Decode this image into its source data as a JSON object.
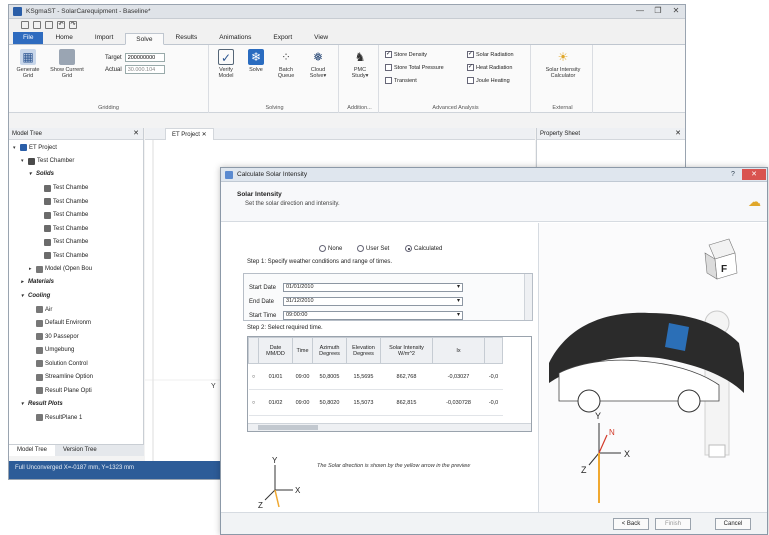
{
  "window": {
    "title": "KSgmaST - SolarCarequipment - Baseline*",
    "controls": [
      "—",
      "❐",
      "✕"
    ]
  },
  "ribbon_tabs": [
    "File",
    "Home",
    "Import",
    "Solve",
    "Results",
    "Animations",
    "Export",
    "View"
  ],
  "ribbon": {
    "grid_group": {
      "label": "Gridding",
      "generate_grid": "Generate Grid",
      "show_current_grid": "Show Current Grid",
      "target_label": "Target",
      "target_value": "200000000",
      "actual_label": "Actual",
      "actual_value": "30.000.104"
    },
    "solving_group": {
      "label": "Solving",
      "verify_model": "Verify Model",
      "solve": "Solve",
      "batch_queue": "Batch Queue",
      "cloud_solve": "Cloud Solve▾"
    },
    "addition_group": {
      "label": "Addition...",
      "pmc_study": "PMC Study▾"
    },
    "analysis_group": {
      "label": "Advanced Analysis",
      "checks": [
        {
          "label": "Store Density",
          "checked": true
        },
        {
          "label": "Solar Radiation",
          "checked": true
        },
        {
          "label": "Store Total Pressure",
          "checked": false
        },
        {
          "label": "Heat Radiation",
          "checked": true
        },
        {
          "label": "Transient",
          "checked": false
        },
        {
          "label": "Joule Heating",
          "checked": false
        }
      ]
    },
    "external_group": {
      "label": "External",
      "solar_calc": "Solar Intensity Calculator"
    }
  },
  "model_tree": {
    "title": "Model Tree",
    "nodes": [
      {
        "label": "ET Project",
        "indent": 0,
        "arrow": "▾",
        "style": "normal"
      },
      {
        "label": "Test Chamber",
        "indent": 1,
        "arrow": "▾",
        "style": "normal"
      },
      {
        "label": "Solids",
        "indent": 2,
        "arrow": "▾",
        "style": "italic"
      },
      {
        "label": "Test Chambe",
        "indent": 3,
        "arrow": "",
        "style": "normal"
      },
      {
        "label": "Test Chambe",
        "indent": 3,
        "arrow": "",
        "style": "normal"
      },
      {
        "label": "Test Chambe",
        "indent": 3,
        "arrow": "",
        "style": "normal"
      },
      {
        "label": "Test Chambe",
        "indent": 3,
        "arrow": "",
        "style": "normal"
      },
      {
        "label": "Test Chambe",
        "indent": 3,
        "arrow": "",
        "style": "normal"
      },
      {
        "label": "Test Chambe",
        "indent": 3,
        "arrow": "",
        "style": "normal"
      },
      {
        "label": "Model (Open Bou",
        "indent": 2,
        "arrow": "▸",
        "style": "normal"
      },
      {
        "label": "Materials",
        "indent": 1,
        "arrow": "▸",
        "style": "italic"
      },
      {
        "label": "Cooling",
        "indent": 1,
        "arrow": "▾",
        "style": "italic"
      },
      {
        "label": "Air",
        "indent": 2,
        "arrow": "",
        "style": "normal"
      },
      {
        "label": "Default Environm",
        "indent": 2,
        "arrow": "",
        "style": "normal"
      },
      {
        "label": "30 Passepor",
        "indent": 2,
        "arrow": "",
        "style": "normal"
      },
      {
        "label": "Umgebung",
        "indent": 2,
        "arrow": "",
        "style": "normal"
      },
      {
        "label": "Solution Control",
        "indent": 2,
        "arrow": "",
        "style": "normal"
      },
      {
        "label": "Streamline Option",
        "indent": 2,
        "arrow": "",
        "style": "normal"
      },
      {
        "label": "Result Plane Opti",
        "indent": 2,
        "arrow": "",
        "style": "normal"
      },
      {
        "label": "Result Plots",
        "indent": 1,
        "arrow": "▾",
        "style": "italic"
      },
      {
        "label": "ResultPlane 1",
        "indent": 2,
        "arrow": "",
        "style": "normal"
      }
    ],
    "bottom_tabs": [
      "Model Tree",
      "Version Tree"
    ]
  },
  "viewport": {
    "tab": "ET Project"
  },
  "property_sheet": {
    "title": "Property Sheet"
  },
  "status": {
    "text": "Full Unconverged   X=-0187 mm, Y=1323 mm"
  },
  "dialog": {
    "title": "Calculate Solar Intensity",
    "heading": "Solar Intensity",
    "subheading": "Set the solar direction and intensity.",
    "mode_options": [
      {
        "label": "None",
        "selected": false
      },
      {
        "label": "User Set",
        "selected": false
      },
      {
        "label": "Calculated",
        "selected": true
      }
    ],
    "step1": "Step 1: Specify weather conditions and range of times.",
    "fields": [
      {
        "label": "Start Date",
        "value": "01/01/2010"
      },
      {
        "label": "End Date",
        "value": "31/12/2010"
      },
      {
        "label": "Start Time",
        "value": "09:00:00"
      }
    ],
    "step2": "Step 2: Select required time.",
    "grid": {
      "columns": [
        "Date MM/DD",
        "Time",
        "Azimuth Degrees",
        "Elevation Degrees",
        "Solar Intensity W/m^2",
        "Ix",
        ""
      ],
      "rows": [
        [
          "01/01",
          "09:00",
          "50,8005",
          "15,5695",
          "862,768",
          "-0,03027",
          "-0,0"
        ],
        [
          "01/02",
          "09:00",
          "50,8020",
          "15,5073",
          "862,815",
          "-0,030728",
          "-0,0"
        ]
      ]
    },
    "note": "The Solar direction is shown by the yellow arrow in the preview",
    "buttons": {
      "back": "< Back",
      "finish": "Finish",
      "cancel": "Cancel"
    },
    "preview_cube_face": "F"
  },
  "axes": {
    "x": "X",
    "y": "Y",
    "z": "Z",
    "n": "N"
  }
}
